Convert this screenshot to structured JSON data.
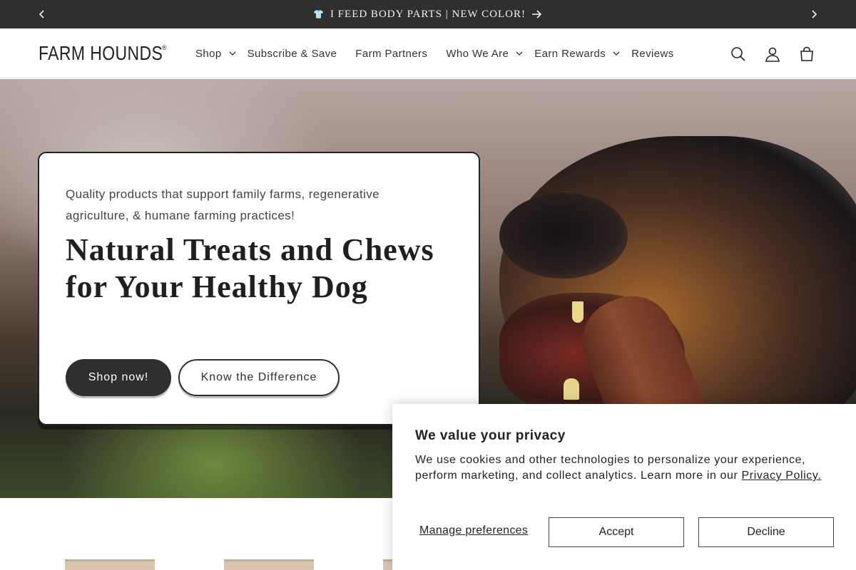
{
  "announcement": {
    "icon": "t-shirt-icon",
    "text": "I FEED BODY PARTS | NEW COLOR!",
    "background": "#2f2f2f"
  },
  "header": {
    "logo_text": "FARM HOUNDS",
    "logo_mark": "®",
    "nav": [
      {
        "label": "Shop",
        "has_dropdown": true
      },
      {
        "label": "Subscribe & Save",
        "has_dropdown": false
      },
      {
        "label": "Farm Partners",
        "has_dropdown": false
      },
      {
        "label": "Who We Are",
        "has_dropdown": true
      },
      {
        "label": "Earn Rewards",
        "has_dropdown": true
      },
      {
        "label": "Reviews",
        "has_dropdown": false
      }
    ],
    "icons": [
      "search-icon",
      "account-icon",
      "cart-icon"
    ]
  },
  "hero": {
    "subtitle": "Quality products that support family farms, regenerative agriculture, & humane farming practices!",
    "title": "Natural Treats and Chews for Your Healthy Dog",
    "primary_button": "Shop now!",
    "secondary_button": "Know the Difference"
  },
  "cookie": {
    "heading": "We value your privacy",
    "body": "We use cookies and other technologies to personalize your experience, perform marketing, and collect analytics. Learn more in our ",
    "link": "Privacy Policy.",
    "manage": "Manage preferences",
    "accept": "Accept",
    "decline": "Decline"
  }
}
